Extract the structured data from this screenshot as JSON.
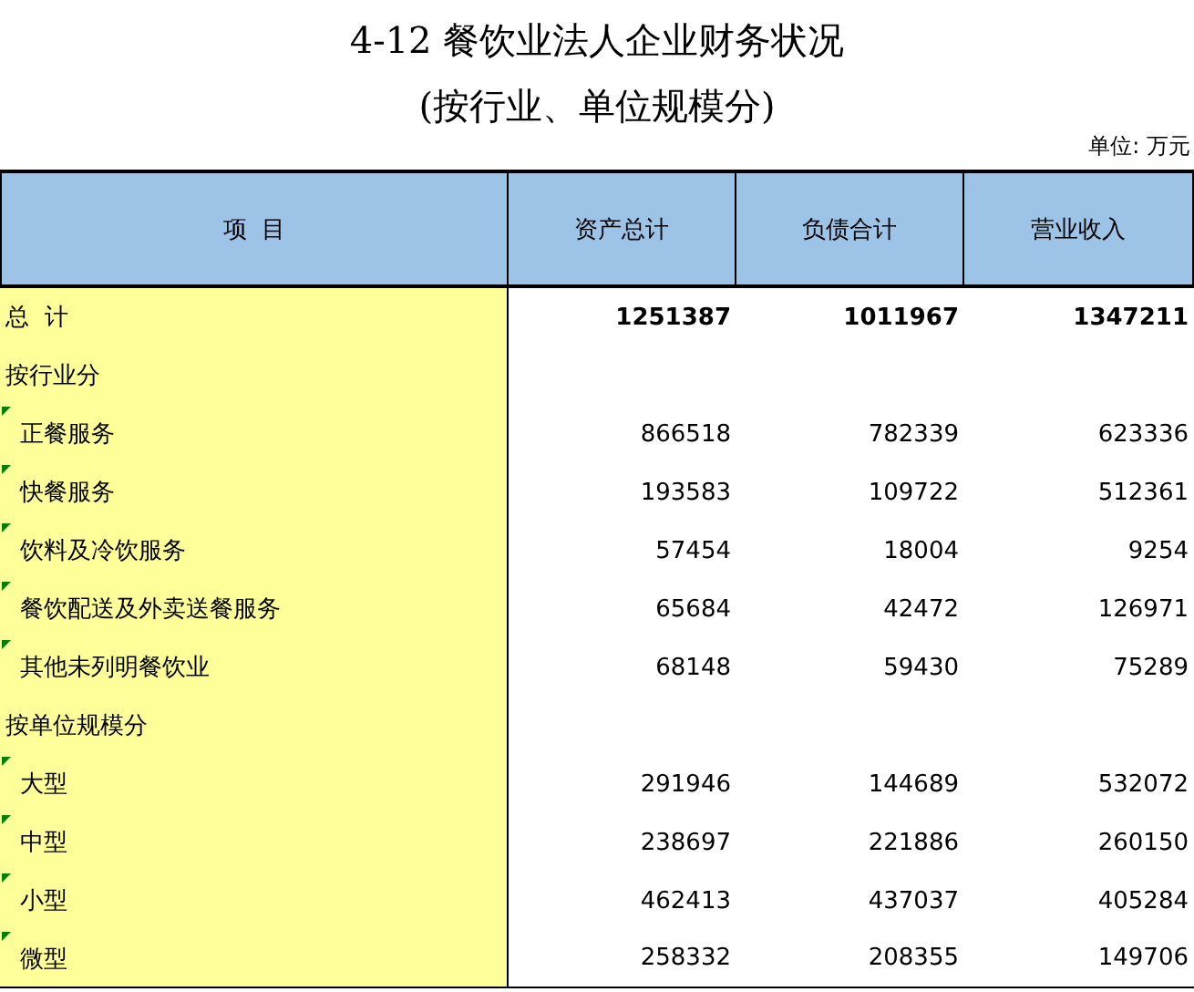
{
  "title": "4-12 餐饮业法人企业财务状况",
  "subtitle": "(按行业、单位规模分)",
  "unit": "单位: 万元",
  "table": {
    "columns": [
      "项  目",
      "资产总计",
      "负债合计",
      "营业收入"
    ],
    "rows": [
      {
        "kind": "total",
        "label": "总  计",
        "values": [
          "1251387",
          "1011967",
          "1347211"
        ]
      },
      {
        "kind": "group",
        "label": "按行业分",
        "values": []
      },
      {
        "kind": "item",
        "label": "正餐服务",
        "values": [
          "866518",
          "782339",
          "623336"
        ]
      },
      {
        "kind": "item",
        "label": "快餐服务",
        "values": [
          "193583",
          "109722",
          "512361"
        ]
      },
      {
        "kind": "item",
        "label": "饮料及冷饮服务",
        "values": [
          "57454",
          "18004",
          "9254"
        ]
      },
      {
        "kind": "item",
        "label": "餐饮配送及外卖送餐服务",
        "values": [
          "65684",
          "42472",
          "126971"
        ]
      },
      {
        "kind": "item",
        "label": "其他未列明餐饮业",
        "values": [
          "68148",
          "59430",
          "75289"
        ]
      },
      {
        "kind": "group",
        "label": "按单位规模分",
        "values": []
      },
      {
        "kind": "item",
        "label": "大型",
        "values": [
          "291946",
          "144689",
          "532072"
        ]
      },
      {
        "kind": "item",
        "label": "中型",
        "values": [
          "238697",
          "221886",
          "260150"
        ]
      },
      {
        "kind": "item",
        "label": "小型",
        "values": [
          "462413",
          "437037",
          "405284"
        ]
      },
      {
        "kind": "item",
        "label": "微型",
        "values": [
          "258332",
          "208355",
          "149706"
        ]
      }
    ]
  }
}
